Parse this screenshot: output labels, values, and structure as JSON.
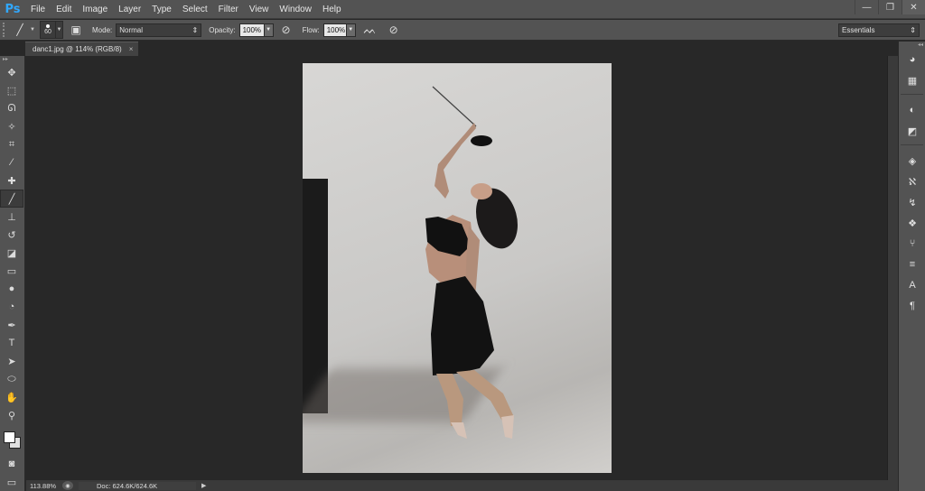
{
  "app": {
    "logo": "Ps"
  },
  "menu": [
    "File",
    "Edit",
    "Image",
    "Layer",
    "Type",
    "Select",
    "Filter",
    "View",
    "Window",
    "Help"
  ],
  "window_controls": {
    "minimize": "—",
    "restore": "❐",
    "close": "✕"
  },
  "options": {
    "brush_size": "60",
    "mode_label": "Mode:",
    "mode_value": "Normal",
    "opacity_label": "Opacity:",
    "opacity_value": "100%",
    "flow_label": "Flow:",
    "flow_value": "100%",
    "workspace": "Essentials"
  },
  "document_tab": {
    "title": "danc1.jpg @ 114% (RGB/8)",
    "close": "×"
  },
  "tools": [
    {
      "name": "move-tool",
      "icon": "move-icon",
      "glyph": "✥"
    },
    {
      "name": "marquee-tool",
      "icon": "marquee-icon",
      "glyph": "⬚"
    },
    {
      "name": "lasso-tool",
      "icon": "lasso-icon",
      "glyph": "ᘏ"
    },
    {
      "name": "quick-select-tool",
      "icon": "magic-wand-icon",
      "glyph": "✧"
    },
    {
      "name": "crop-tool",
      "icon": "crop-icon",
      "glyph": "⌗"
    },
    {
      "name": "eyedropper-tool",
      "icon": "eyedropper-icon",
      "glyph": "⁄"
    },
    {
      "name": "healing-brush-tool",
      "icon": "bandage-icon",
      "glyph": "✚"
    },
    {
      "name": "brush-tool",
      "icon": "brush-icon",
      "glyph": "╱",
      "active": true
    },
    {
      "name": "clone-stamp-tool",
      "icon": "stamp-icon",
      "glyph": "⊥"
    },
    {
      "name": "history-brush-tool",
      "icon": "history-brush-icon",
      "glyph": "↺"
    },
    {
      "name": "eraser-tool",
      "icon": "eraser-icon",
      "glyph": "◪"
    },
    {
      "name": "gradient-tool",
      "icon": "gradient-icon",
      "glyph": "▭"
    },
    {
      "name": "blur-tool",
      "icon": "drop-icon",
      "glyph": "●"
    },
    {
      "name": "dodge-tool",
      "icon": "dodge-icon",
      "glyph": "◔"
    },
    {
      "name": "pen-tool",
      "icon": "pen-icon",
      "glyph": "✒"
    },
    {
      "name": "type-tool",
      "icon": "type-icon",
      "glyph": "T"
    },
    {
      "name": "path-select-tool",
      "icon": "arrow-icon",
      "glyph": "➤"
    },
    {
      "name": "shape-tool",
      "icon": "ellipse-icon",
      "glyph": "⬭"
    },
    {
      "name": "hand-tool",
      "icon": "hand-icon",
      "glyph": "✋"
    },
    {
      "name": "zoom-tool",
      "icon": "magnifier-icon",
      "glyph": "⚲"
    }
  ],
  "colors": {
    "foreground": "#ffffff",
    "background": "#e0e0e0"
  },
  "status": {
    "zoom": "113.88%",
    "doc": "Doc: 624.6K/624.6K",
    "arrow": "▶"
  },
  "panel_icons": [
    {
      "name": "color-panel-button",
      "icon": "palette-icon",
      "glyph": "◕"
    },
    {
      "name": "swatches-panel-button",
      "icon": "swatches-icon",
      "glyph": "▦"
    },
    {
      "name": "adjustments-panel-button",
      "icon": "adjustments-icon",
      "glyph": "◐"
    },
    {
      "name": "styles-panel-button",
      "icon": "styles-icon",
      "glyph": "◩"
    },
    {
      "name": "layers-panel-button",
      "icon": "layers-icon",
      "glyph": "◈"
    },
    {
      "name": "channels-panel-button",
      "icon": "channels-icon",
      "glyph": "ℵ"
    },
    {
      "name": "history-panel-button",
      "icon": "history-icon",
      "glyph": "↯"
    },
    {
      "name": "actions-panel-button",
      "icon": "actions-icon",
      "glyph": "❖"
    },
    {
      "name": "brush-panel-button",
      "icon": "brush-presets-icon",
      "glyph": "⑂"
    },
    {
      "name": "properties-panel-button",
      "icon": "properties-icon",
      "glyph": "≡"
    },
    {
      "name": "character-panel-button",
      "icon": "character-icon",
      "glyph": "A"
    },
    {
      "name": "paragraph-panel-button",
      "icon": "paragraph-icon",
      "glyph": "¶"
    }
  ]
}
